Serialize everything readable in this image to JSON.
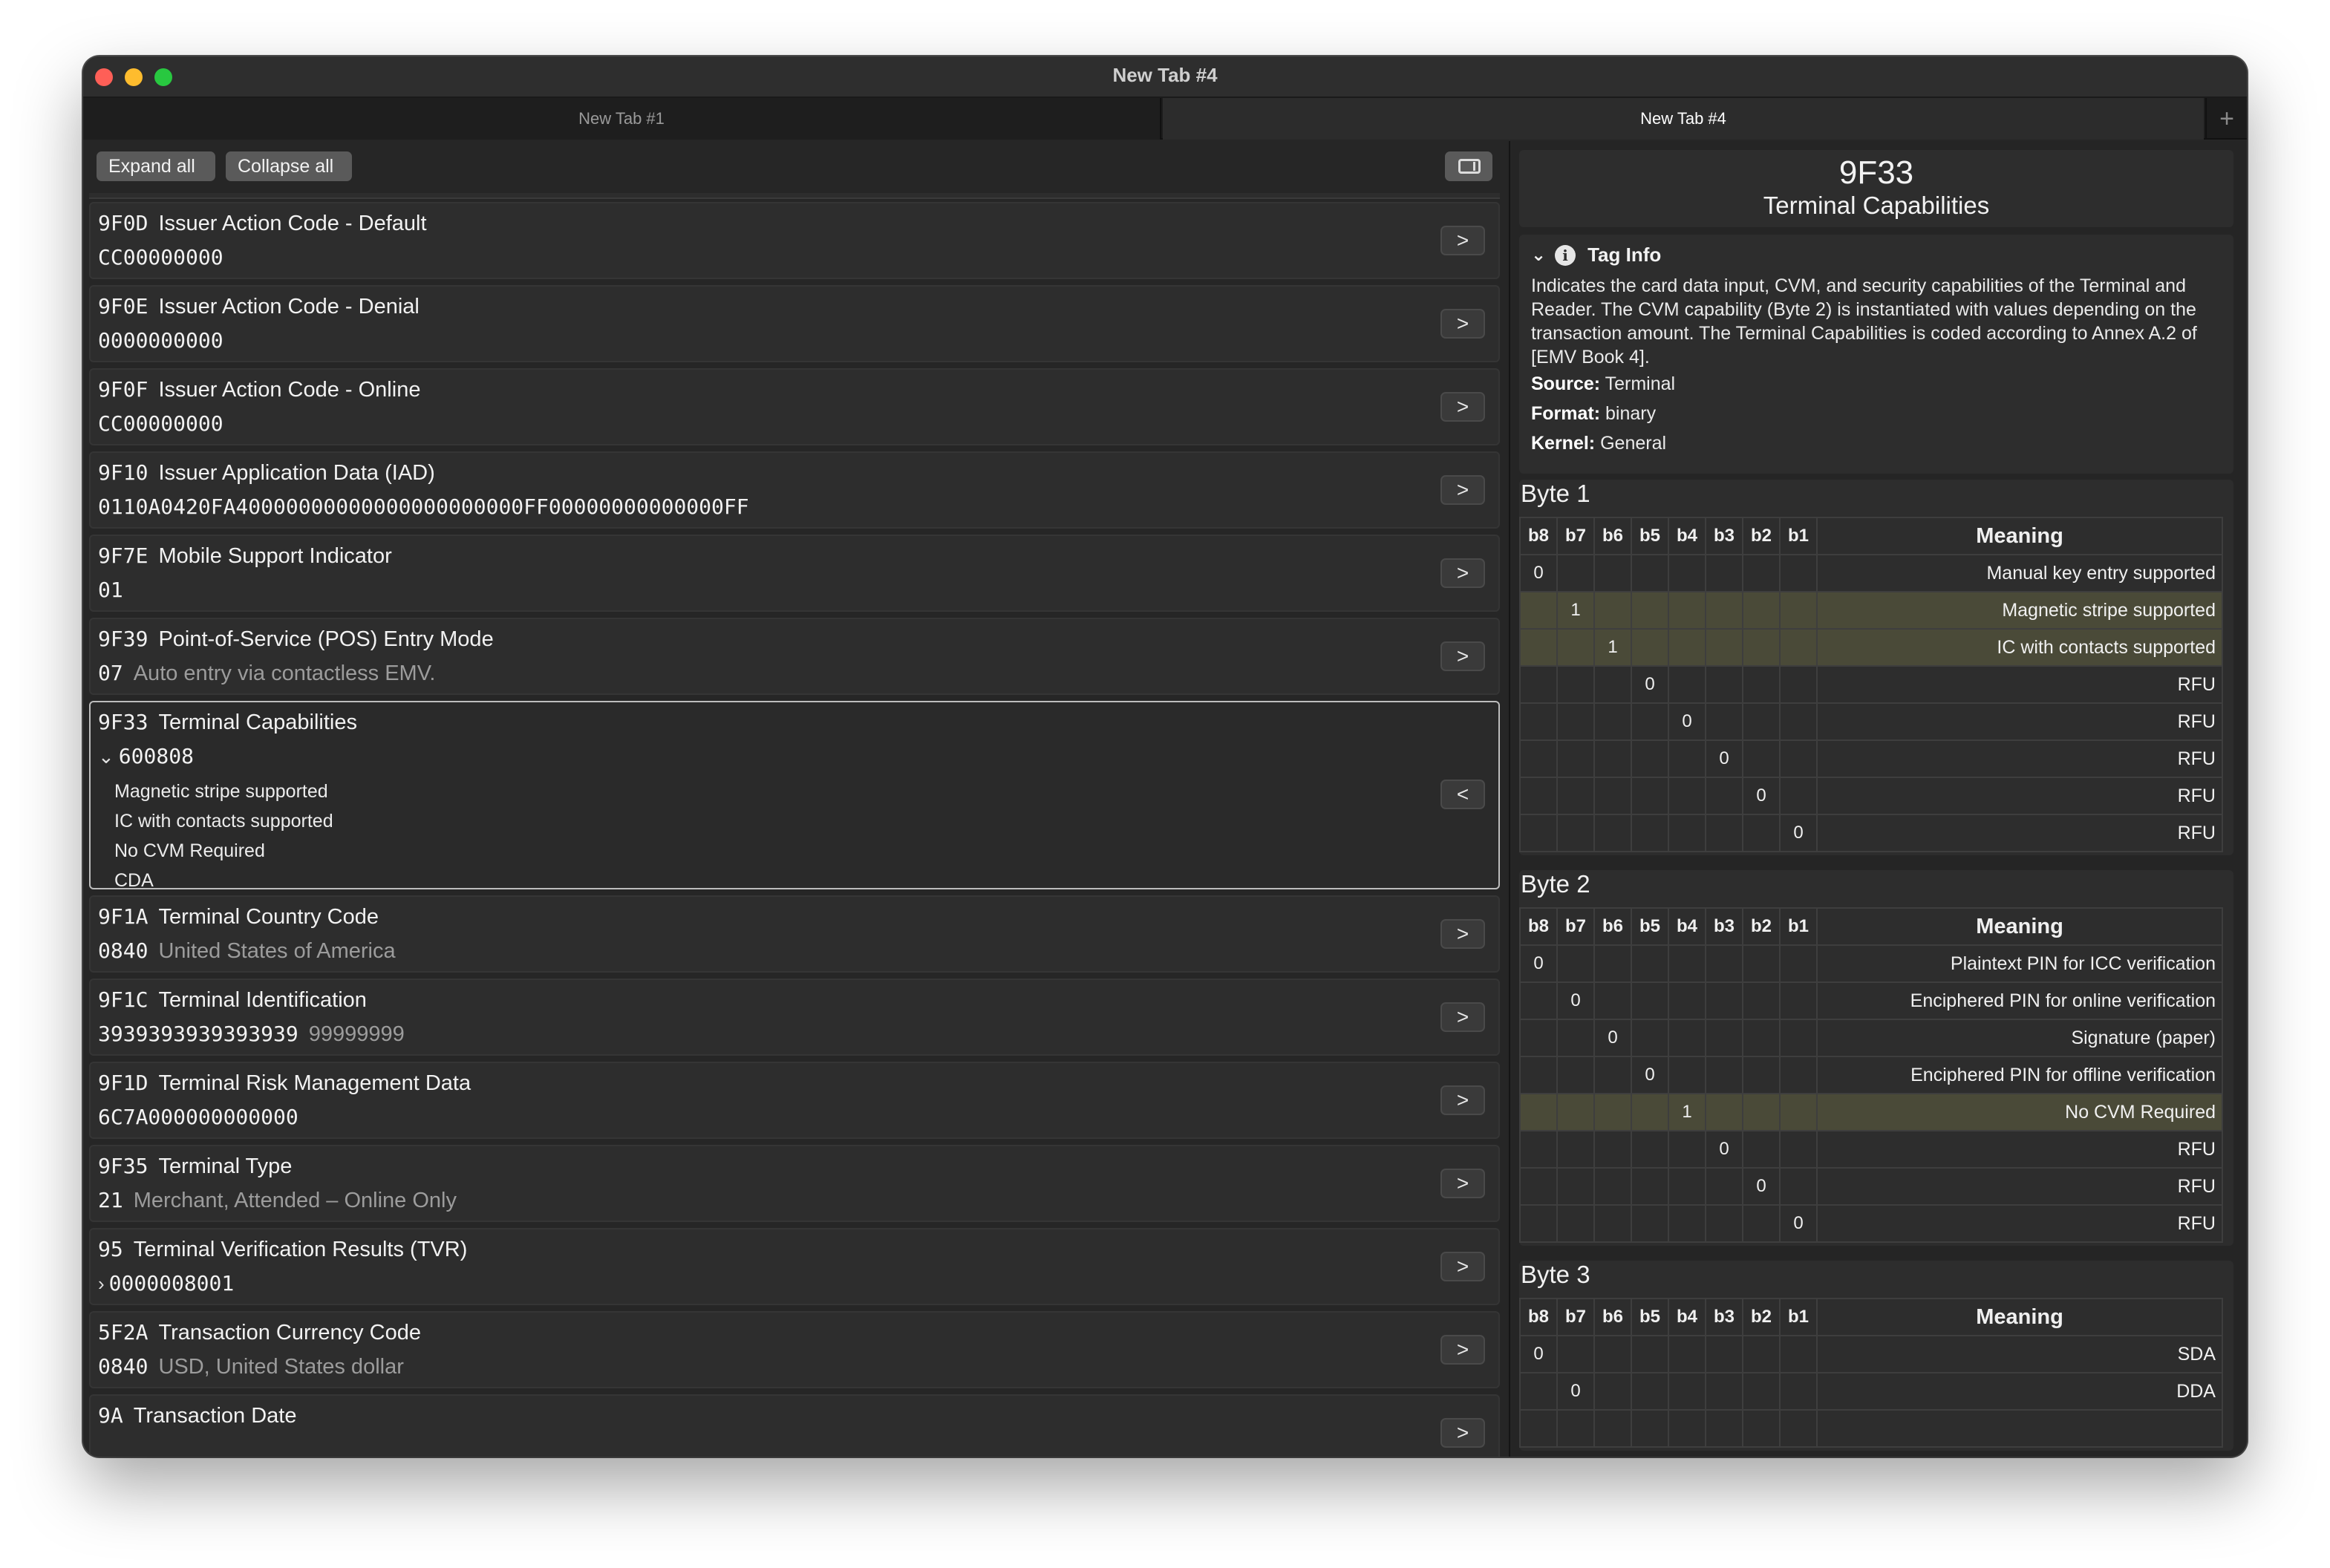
{
  "window": {
    "title": "New Tab #4"
  },
  "tabs": [
    {
      "label": "New Tab #1",
      "active": false
    },
    {
      "label": "New Tab #4",
      "active": true
    }
  ],
  "tab_add_label": "+",
  "toolbar": {
    "expand_all": "Expand all",
    "collapse_all": "Collapse all"
  },
  "entries": [
    {
      "tag": "9F0D",
      "name": "Issuer Action Code - Default",
      "value": "CC00000000",
      "desc": "",
      "chevron": "",
      "button": ">"
    },
    {
      "tag": "9F0E",
      "name": "Issuer Action Code - Denial",
      "value": "0000000000",
      "desc": "",
      "chevron": "",
      "button": ">"
    },
    {
      "tag": "9F0F",
      "name": "Issuer Action Code - Online",
      "value": "CC00000000",
      "desc": "",
      "chevron": "",
      "button": ">"
    },
    {
      "tag": "9F10",
      "name": "Issuer Application Data (IAD)",
      "value": "0110A0420FA40000000000000000000000FF00000000000000FF",
      "desc": "",
      "chevron": "",
      "button": ">"
    },
    {
      "tag": "9F7E",
      "name": "Mobile Support Indicator",
      "value": "01",
      "desc": "",
      "chevron": "",
      "button": ">"
    },
    {
      "tag": "9F39",
      "name": "Point-of-Service (POS) Entry Mode",
      "value": "07",
      "desc": "Auto entry via contactless EMV.",
      "chevron": "",
      "button": ">"
    },
    {
      "tag": "9F33",
      "name": "Terminal Capabilities",
      "value": "600808",
      "desc": "",
      "chevron": "⌄",
      "button": "<",
      "details": [
        "Magnetic stripe supported",
        "IC with contacts supported",
        "No CVM Required",
        "CDA"
      ]
    },
    {
      "tag": "9F1A",
      "name": "Terminal Country Code",
      "value": "0840",
      "desc": "United States of America",
      "chevron": "",
      "button": ">"
    },
    {
      "tag": "9F1C",
      "name": "Terminal Identification",
      "value": "3939393939393939",
      "desc": "99999999",
      "chevron": "",
      "button": ">"
    },
    {
      "tag": "9F1D",
      "name": "Terminal Risk Management Data",
      "value": "6C7A000000000000",
      "desc": "",
      "chevron": "",
      "button": ">"
    },
    {
      "tag": "9F35",
      "name": "Terminal Type",
      "value": "21",
      "desc": "Merchant, Attended – Online Only",
      "chevron": "",
      "button": ">"
    },
    {
      "tag": "95",
      "name": "Terminal Verification Results (TVR)",
      "value": "0000008001",
      "desc": "",
      "chevron": "›",
      "button": ">"
    },
    {
      "tag": "5F2A",
      "name": "Transaction Currency Code",
      "value": "0840",
      "desc": "USD, United States dollar",
      "chevron": "",
      "button": ">"
    },
    {
      "tag": "9A",
      "name": "Transaction Date",
      "value": "",
      "desc": "",
      "chevron": "",
      "button": ">"
    }
  ],
  "detail": {
    "tag": "9F33",
    "name": "Terminal Capabilities",
    "info_title": "Tag Info",
    "description": "Indicates the card data input, CVM, and security capabilities of the Terminal and Reader. The CVM capability (Byte 2) is instantiated with values depending on the transaction amount. The Terminal Capabilities is coded according to Annex A.2 of [EMV Book 4].",
    "source_label": "Source:",
    "source": "Terminal",
    "format_label": "Format:",
    "format": "binary",
    "kernel_label": "Kernel:",
    "kernel": "General",
    "bit_headers": [
      "b8",
      "b7",
      "b6",
      "b5",
      "b4",
      "b3",
      "b2",
      "b1"
    ],
    "meaning_header": "Meaning",
    "bytes": [
      {
        "title": "Byte 1",
        "rows": [
          {
            "bit": 0,
            "value": "0",
            "meaning": "Manual key entry supported",
            "highlight": false
          },
          {
            "bit": 1,
            "value": "1",
            "meaning": "Magnetic stripe supported",
            "highlight": true
          },
          {
            "bit": 2,
            "value": "1",
            "meaning": "IC with contacts supported",
            "highlight": true
          },
          {
            "bit": 3,
            "value": "0",
            "meaning": "RFU",
            "highlight": false
          },
          {
            "bit": 4,
            "value": "0",
            "meaning": "RFU",
            "highlight": false
          },
          {
            "bit": 5,
            "value": "0",
            "meaning": "RFU",
            "highlight": false
          },
          {
            "bit": 6,
            "value": "0",
            "meaning": "RFU",
            "highlight": false
          },
          {
            "bit": 7,
            "value": "0",
            "meaning": "RFU",
            "highlight": false
          }
        ]
      },
      {
        "title": "Byte 2",
        "rows": [
          {
            "bit": 0,
            "value": "0",
            "meaning": "Plaintext PIN for ICC verification",
            "highlight": false
          },
          {
            "bit": 1,
            "value": "0",
            "meaning": "Enciphered PIN for online verification",
            "highlight": false
          },
          {
            "bit": 2,
            "value": "0",
            "meaning": "Signature (paper)",
            "highlight": false
          },
          {
            "bit": 3,
            "value": "0",
            "meaning": "Enciphered PIN for offline verification",
            "highlight": false
          },
          {
            "bit": 4,
            "value": "1",
            "meaning": "No CVM Required",
            "highlight": true
          },
          {
            "bit": 5,
            "value": "0",
            "meaning": "RFU",
            "highlight": false
          },
          {
            "bit": 6,
            "value": "0",
            "meaning": "RFU",
            "highlight": false
          },
          {
            "bit": 7,
            "value": "0",
            "meaning": "RFU",
            "highlight": false
          }
        ]
      },
      {
        "title": "Byte 3",
        "rows": [
          {
            "bit": 0,
            "value": "0",
            "meaning": "SDA",
            "highlight": false
          },
          {
            "bit": 1,
            "value": "0",
            "meaning": "DDA",
            "highlight": false
          },
          {
            "bit": 2,
            "value": "",
            "meaning": "",
            "highlight": false
          }
        ]
      }
    ]
  }
}
